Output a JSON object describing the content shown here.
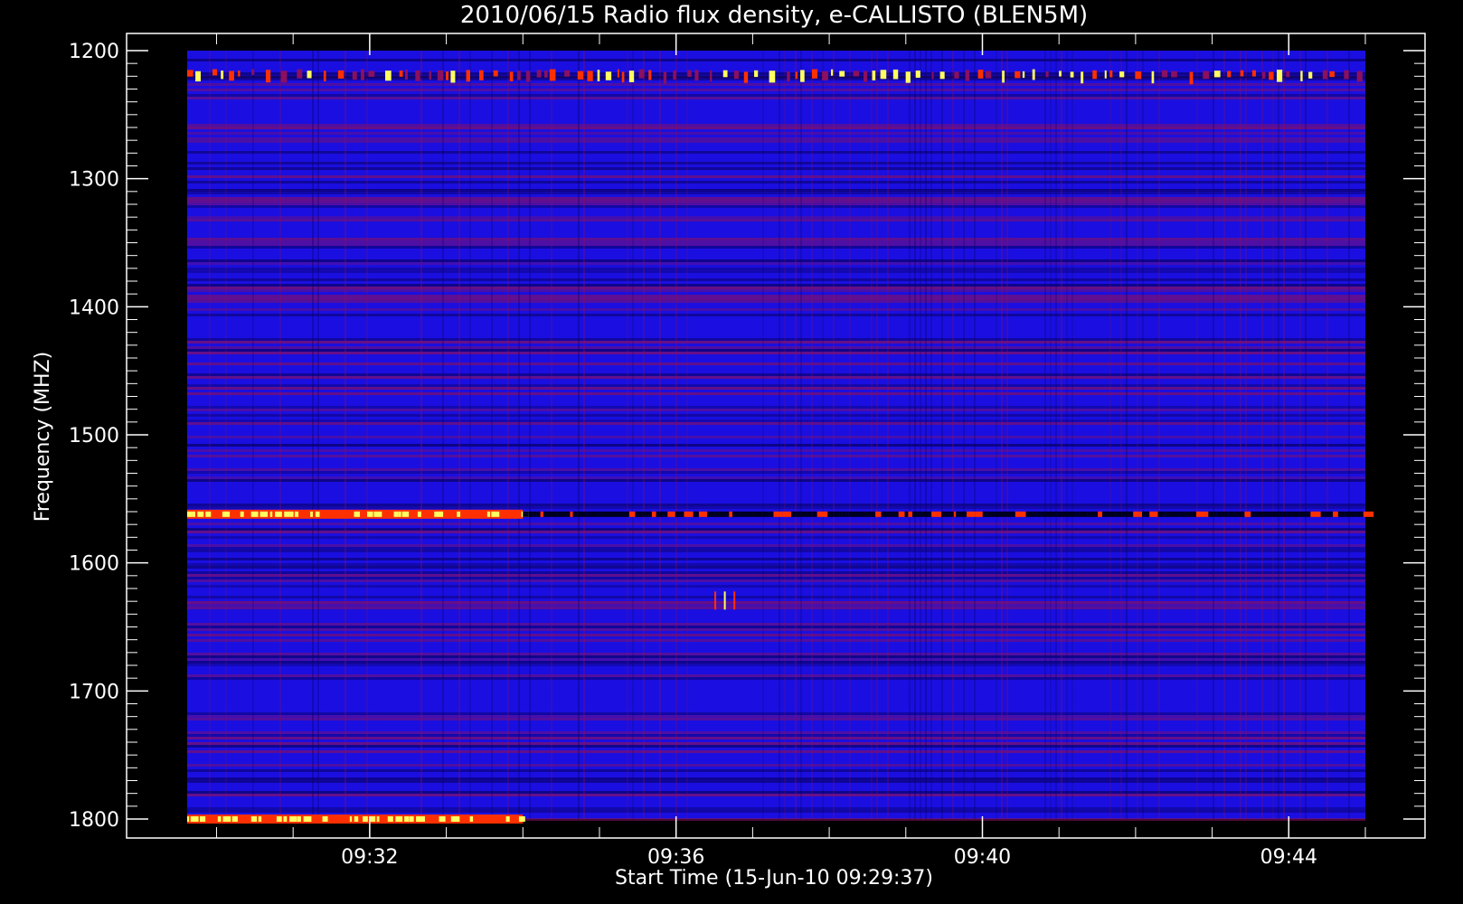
{
  "chart_data": {
    "type": "heatmap",
    "title": "2010/06/15  Radio flux density, e-CALLISTO (BLEN5M)",
    "xlabel": "Start Time (15-Jun-10 09:29:37)",
    "ylabel": "Frequency (MHZ)",
    "x_range": [
      "09:29:37",
      "09:45:00"
    ],
    "ylim": [
      1200,
      1800
    ],
    "y_inverted": true,
    "y_unit": "MHz",
    "x_ticks": [
      "09:32",
      "09:36",
      "09:40",
      "09:44"
    ],
    "y_ticks": [
      1200,
      1300,
      1400,
      1500,
      1600,
      1700,
      1800
    ],
    "colormap": {
      "background": "#1a0fe0",
      "low": "#0a0060",
      "mid": "#8a1060",
      "high": "#ff3000",
      "peak": "#ffff60"
    },
    "features": [
      {
        "name": "band-1220",
        "frequency": 1218,
        "start": "09:29:37",
        "end": "09:45:00",
        "intensity": "medium-intermittent"
      },
      {
        "name": "band-1562",
        "frequency": 1562,
        "start": "09:29:37",
        "end": "09:34:00",
        "intensity": "high"
      },
      {
        "name": "band-1562-dark",
        "frequency": 1562,
        "start": "09:34:00",
        "end": "09:45:00",
        "intensity": "low"
      },
      {
        "name": "band-1800",
        "frequency": 1800,
        "start": "09:29:37",
        "end": "09:34:00",
        "intensity": "high"
      },
      {
        "name": "burst-1628",
        "frequency": 1628,
        "start": "09:36:30",
        "end": "09:36:45",
        "intensity": "medium"
      }
    ]
  }
}
